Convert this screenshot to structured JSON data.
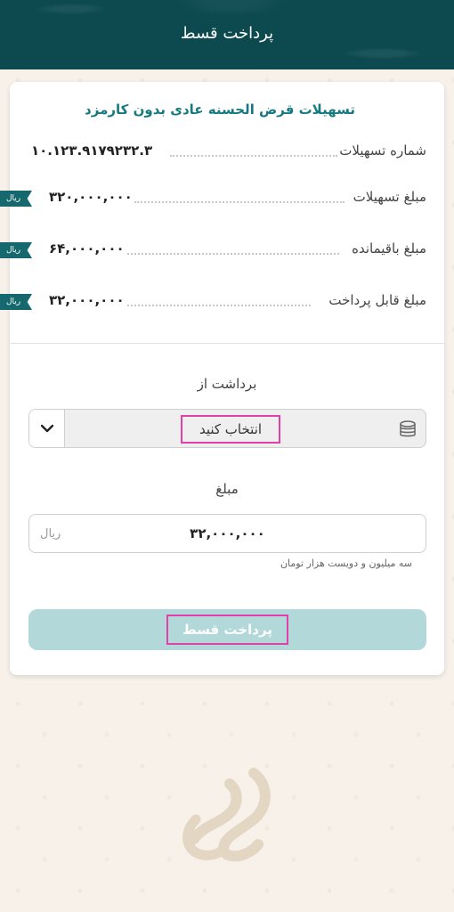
{
  "header": {
    "title": "پرداخت قسط"
  },
  "loan": {
    "title": "تسهیلات قرض الحسنه عادی بدون کارمزد",
    "rows": [
      {
        "label": "شماره تسهیلات",
        "value": "۱۰.۱۲۳.۹۱۷۹۲۳۲.۳",
        "unit": ""
      },
      {
        "label": "مبلغ تسهیلات",
        "value": "۳۲۰,۰۰۰,۰۰۰",
        "unit": "ریال"
      },
      {
        "label": "مبلغ باقیمانده",
        "value": "۶۴,۰۰۰,۰۰۰",
        "unit": "ریال"
      },
      {
        "label": "مبلغ قابل پرداخت",
        "value": "۳۲,۰۰۰,۰۰۰",
        "unit": "ریال"
      }
    ]
  },
  "withdraw": {
    "label": "برداشت از",
    "select_placeholder": "انتخاب کنید",
    "icon": "coins-icon"
  },
  "amount": {
    "label": "مبلغ",
    "value": "۳۲,۰۰۰,۰۰۰",
    "unit": "ریال",
    "in_words": "سه  میلیون و دویست  هزار تومان"
  },
  "submit": {
    "label": "پرداخت قسط"
  },
  "colors": {
    "header": "#0d4a50",
    "accent": "#157a7f",
    "button_disabled": "#b2d8da",
    "highlight": "#e040a8"
  }
}
